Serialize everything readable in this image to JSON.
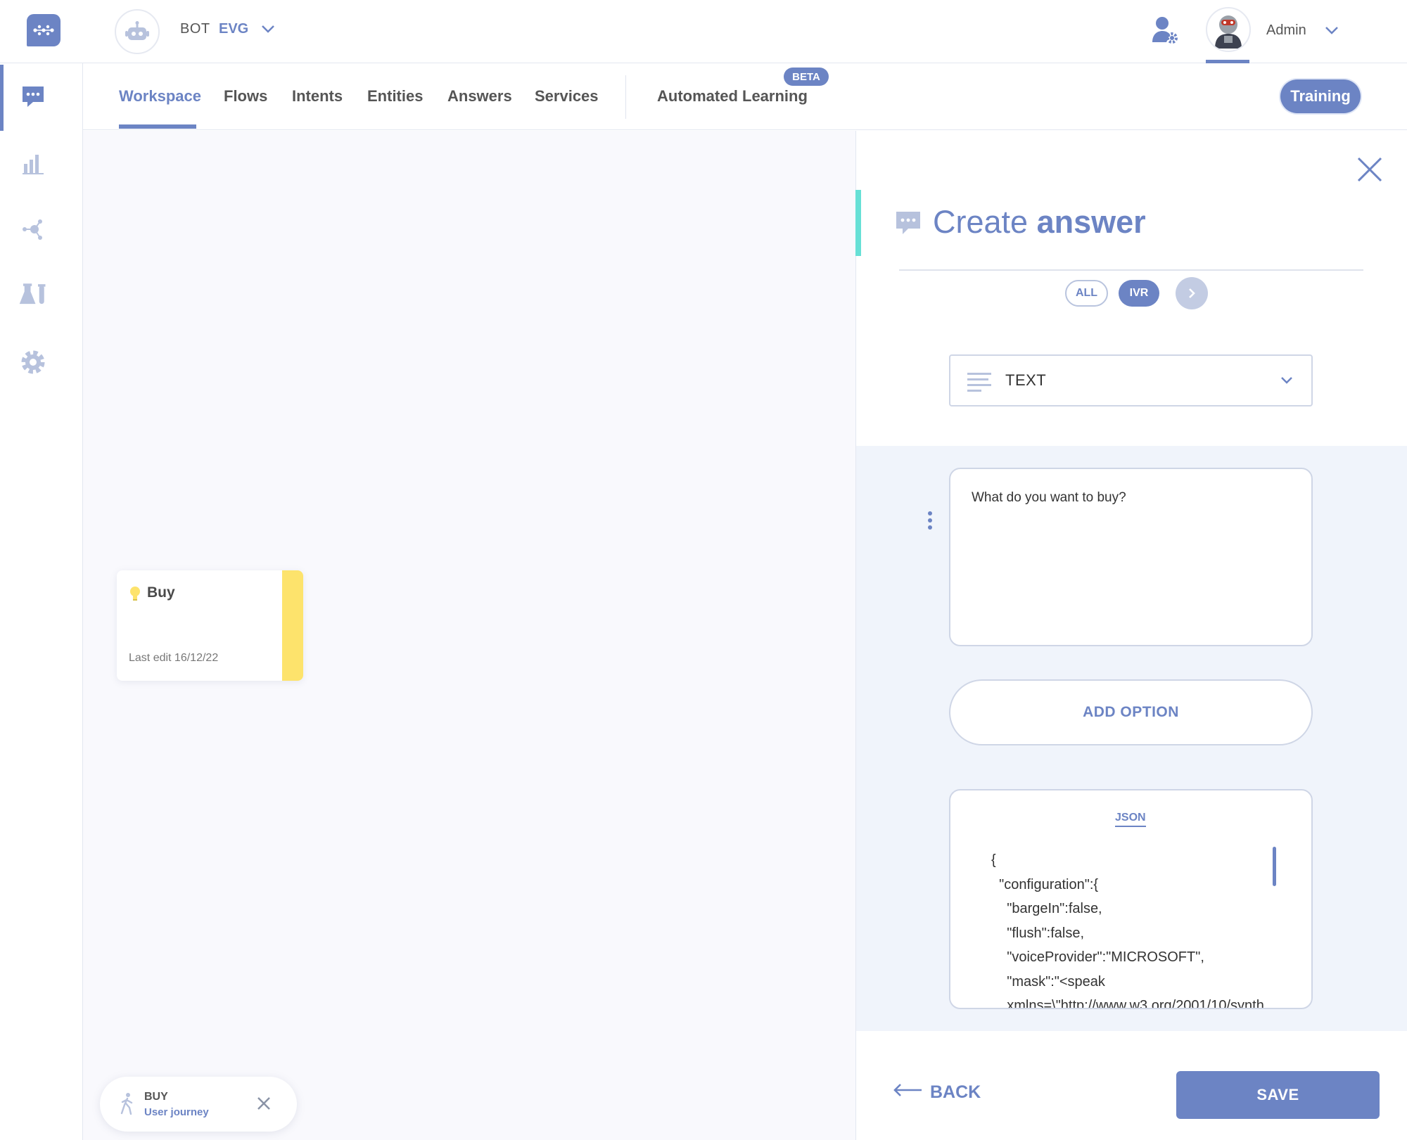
{
  "header": {
    "bot_label": "BOT",
    "bot_name": "EVG",
    "user_name": "Admin"
  },
  "tabs": [
    {
      "label": "Workspace",
      "active": true
    },
    {
      "label": "Flows"
    },
    {
      "label": "Intents"
    },
    {
      "label": "Entities"
    },
    {
      "label": "Answers"
    },
    {
      "label": "Services"
    },
    {
      "label": "Automated Learning",
      "badge": "BETA"
    }
  ],
  "training_label": "Training",
  "sidebar": {
    "items": [
      {
        "icon": "chat-icon",
        "active": true
      },
      {
        "icon": "bar-chart-icon"
      },
      {
        "icon": "network-icon"
      },
      {
        "icon": "lab-flask-icon"
      },
      {
        "icon": "gear-icon"
      }
    ]
  },
  "canvas": {
    "node": {
      "title": "Buy",
      "last_edit": "Last edit 16/12/22",
      "icon": "lightbulb-icon"
    },
    "journey": {
      "label": "BUY",
      "sub": "User journey"
    }
  },
  "panel": {
    "title_light": "Create",
    "title_bold": "answer",
    "pills": {
      "all": "ALL",
      "ivr": "IVR"
    },
    "type_select": "TEXT",
    "answer_text": "What do you want to buy?",
    "add_option": "ADD OPTION",
    "json_tab": "JSON",
    "json_code": "{\n  \"configuration\":{\n    \"bargeIn\":false,\n    \"flush\":false,\n    \"voiceProvider\":\"MICROSOFT\",\n    \"mask\":\"<speak\n    xmlns=\\\"http://www.w3.org/2001/10/synth",
    "back": "BACK",
    "save": "SAVE"
  },
  "colors": {
    "accent": "#6c84c4",
    "teal_accent": "#67e0d6",
    "node_stripe": "#fde36c"
  }
}
